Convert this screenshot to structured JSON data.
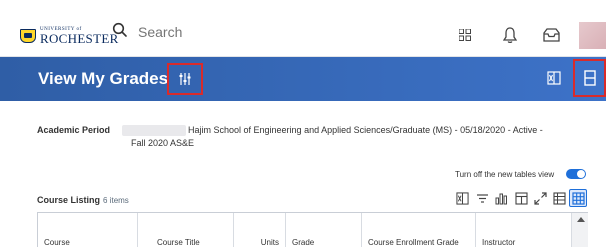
{
  "topbar": {
    "logo_small": "UNIVERSITY of",
    "logo_big": "ROCHESTER",
    "search_placeholder": "Search",
    "icons": [
      "apps-grid-icon",
      "bell-icon",
      "inbox-icon"
    ]
  },
  "header": {
    "title": "View My Grades",
    "bg_color": "#3565b0",
    "highlight_color": "#d92b2b"
  },
  "details": {
    "period_label": "Academic Period",
    "period_value_line1": "Hajim School of Engineering and Applied Sciences/Graduate (MS) - 05/18/2020 - Active -",
    "period_value_line2": "Fall 2020 AS&E"
  },
  "toggle": {
    "label": "Turn off the new tables view",
    "on": true
  },
  "listing": {
    "title": "Course Listing",
    "count": "6 items"
  },
  "table": {
    "columns": [
      "Course",
      "Course Title",
      "Units",
      "Grade",
      "Course Enrollment Grade Points",
      "Instructor"
    ]
  }
}
